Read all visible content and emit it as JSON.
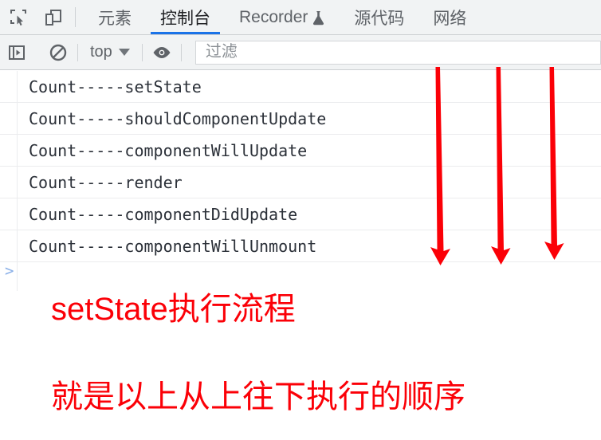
{
  "window": {
    "title": "Chrome DevTools Console"
  },
  "toolbar_icons": {
    "inspect": "inspect-element-icon",
    "device": "device-toolbar-icon"
  },
  "tabs": [
    {
      "label": "元素",
      "active": false,
      "icon": null
    },
    {
      "label": "控制台",
      "active": true,
      "icon": null
    },
    {
      "label": "Recorder",
      "active": false,
      "icon": "flask-icon"
    },
    {
      "label": "源代码",
      "active": false,
      "icon": null
    },
    {
      "label": "网络",
      "active": false,
      "icon": null
    }
  ],
  "console_toolbar": {
    "sidebar_toggle_icon": "console-sidebar-icon",
    "clear_icon": "clear-console-icon",
    "context_label": "top",
    "context_caret_icon": "caret-down-icon",
    "eye_icon": "live-expression-eye-icon",
    "filter_placeholder": "过滤",
    "filter_value": ""
  },
  "console_logs": [
    {
      "text": "Count-----setState"
    },
    {
      "text": "Count-----shouldComponentUpdate"
    },
    {
      "text": "Count-----componentWillUpdate"
    },
    {
      "text": "Count-----render"
    },
    {
      "text": "Count-----componentDidUpdate"
    },
    {
      "text": "Count-----componentWillUnmount"
    }
  ],
  "prompt": {
    "chevron": ">",
    "value": ""
  },
  "annotations": [
    {
      "text": "setState执行流程",
      "color": "#fb0007"
    },
    {
      "text": "就是以上从上往下执行的顺序",
      "color": "#fb0007"
    }
  ],
  "arrows": {
    "color": "#fb0007",
    "count": 3,
    "direction": "down"
  },
  "colors": {
    "accent": "#1a73e8",
    "annotation": "#fb0007",
    "toolbar_bg": "#f1f3f4",
    "log_text": "#2b3038",
    "prompt_chevron": "#8ab0e8"
  }
}
